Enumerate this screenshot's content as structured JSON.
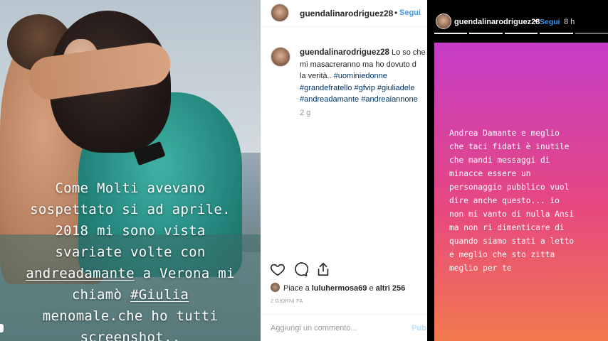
{
  "left_story": {
    "lines": [
      {
        "text": "Come Molti avevano"
      },
      {
        "text": "sospettato si ad aprile."
      },
      {
        "text": "2018 mi sono vista"
      },
      {
        "text": "svariate volte con"
      },
      {
        "mention": "andreadamante",
        "text_after": " a Verona mi"
      },
      {
        "text_before": "chiamò ",
        "tag": "#Giulia"
      },
      {
        "text": "menomale.che ho tutti"
      },
      {
        "text": "screenshot.."
      }
    ]
  },
  "post": {
    "header": {
      "username": "guendalinarodriguez28",
      "separator": "•",
      "follow_label": "Segui"
    },
    "caption": {
      "username": "guendalinarodriguez28",
      "line1_text": " Lo so che",
      "line2_text": "mi masacreranno ma ho dovuto d",
      "line3_text": "la verità.. ",
      "hashtag_uominiedonne": "#uominiedonne",
      "hashtag_grandefratello": "#grandefratello",
      "hashtag_gfvip": "#gfvip",
      "hashtag_giuliade": "#giuliadele",
      "hashtag_andreadamante": "#andreadamante",
      "hashtag_andreaiannone": "#andreaiannone"
    },
    "time_ago": "2 g",
    "icons": {
      "like": "heart-icon",
      "comment": "comment-icon",
      "share": "share-icon"
    },
    "likes": {
      "prefix": "Piace a ",
      "user": "luluhermosa69",
      "middle": " e ",
      "others": "altri 256"
    },
    "date": "2 GIORNI FA",
    "add_comment_placeholder": "Aggiungi un commento...",
    "publish_label": "Pub"
  },
  "right_story": {
    "username": "guendalinarodriguez28",
    "separator": "•",
    "follow_label": "Segui",
    "age": "8 h",
    "progress_segments": 5,
    "lines": [
      "Andrea Damante e meglio",
      "che taci fidati è inutile",
      "che mandi messaggi di",
      "minacce essere un",
      "personaggio pubblico vuol",
      "dire anche questo... io",
      "non mi vanto di nulla Ansi",
      "ma non ri dimenticare di",
      "quando siamo stati a letto",
      "e meglio che sto zitta",
      "meglio per te"
    ],
    "gradient": [
      "#c53cc8",
      "#e6487f",
      "#f37a4e"
    ]
  }
}
